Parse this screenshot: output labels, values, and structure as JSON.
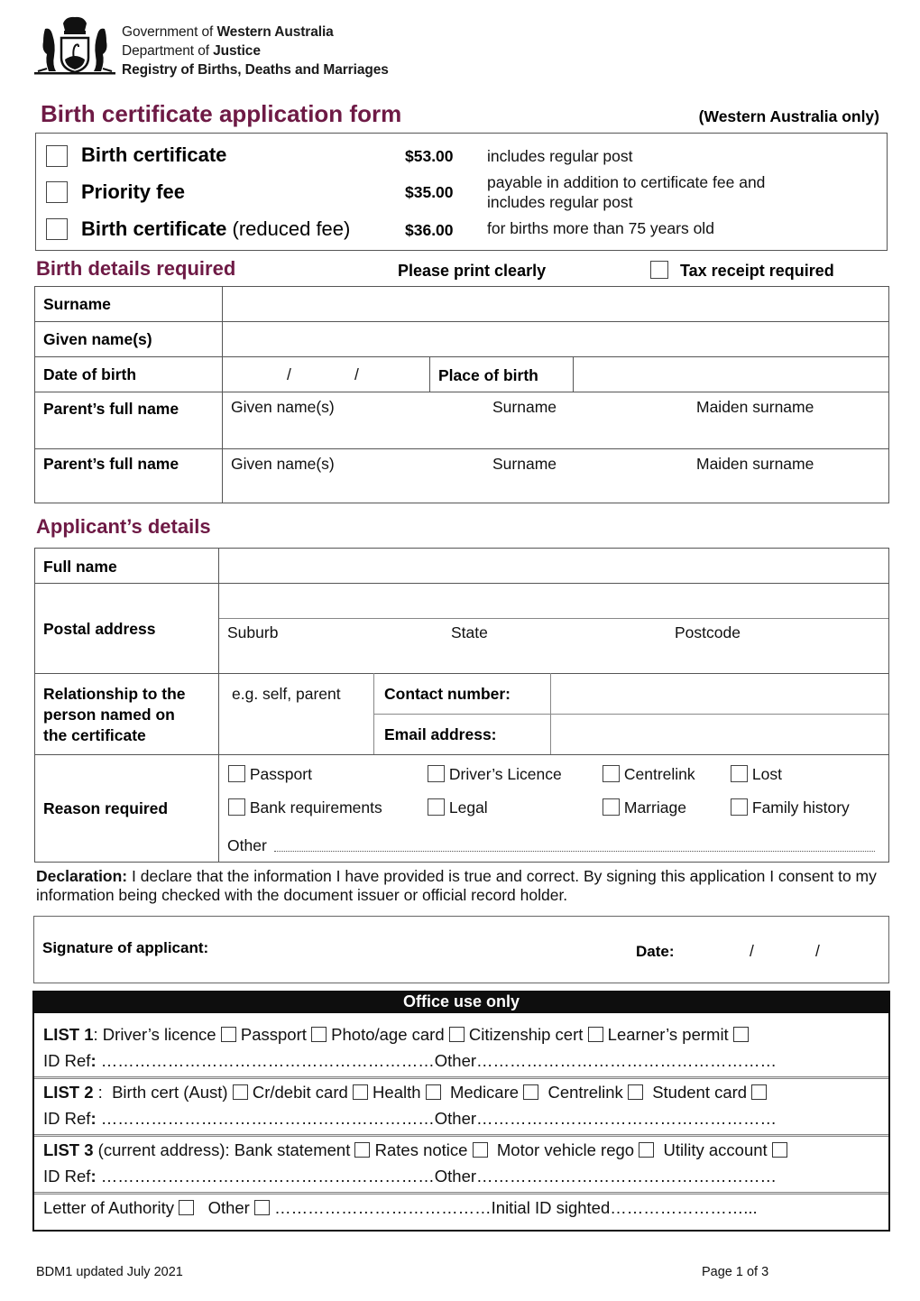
{
  "header": {
    "logo_icon": "wa-coat-of-arms-icon",
    "org_line1_normal": "Government of ",
    "org_line1_bold": "Western Australia",
    "org_line2_normal": "Department of ",
    "org_line2_bold": "Justice",
    "org_line3": "Registry of Births, Deaths and Marriages"
  },
  "title": "Birth certificate application form",
  "title_note": "(Western Australia only)",
  "colors": {
    "accent": "#6e1a45",
    "office_bar": "#0e0e0e"
  },
  "fees": [
    {
      "label": "Birth certificate",
      "label_suffix": "",
      "price": "$53.00",
      "description": [
        "includes regular post"
      ]
    },
    {
      "label": "Priority fee",
      "label_suffix": "",
      "price": "$35.00",
      "description": [
        "payable in addition to certificate fee and",
        "includes regular post"
      ]
    },
    {
      "label": "Birth certificate",
      "label_suffix": " (reduced fee)",
      "price": "$36.00",
      "description": [
        "for births more than 75 years old"
      ]
    }
  ],
  "birth_details": {
    "heading": "Birth details required",
    "print_note": "Please print clearly",
    "tax_receipt": "Tax receipt required",
    "surname": "Surname",
    "given_names": "Given name(s)",
    "date_of_birth": "Date of birth",
    "date_sep": "/",
    "place_of_birth": "Place of birth",
    "parents": [
      {
        "label": "Parent’s full name",
        "given": "Given name(s)",
        "surname": "Surname",
        "maiden": "Maiden surname"
      },
      {
        "label": "Parent’s full name",
        "given": "Given name(s)",
        "surname": "Surname",
        "maiden": "Maiden surname"
      }
    ]
  },
  "applicant": {
    "heading": "Applicant’s details",
    "full_name": "Full name",
    "postal_address": "Postal address",
    "suburb": "Suburb",
    "state": "State",
    "postcode": "Postcode",
    "relationship_lines": [
      "Relationship to the",
      "person named on",
      "the certificate"
    ],
    "relationship_hint": "e.g. self, parent",
    "contact_number": "Contact number:",
    "email_address": "Email address:",
    "reason_required": "Reason required",
    "reasons": [
      "Passport",
      "Driver’s Licence",
      "Centrelink",
      "Lost",
      "Bank requirements",
      "Legal",
      "Marriage",
      "Family history"
    ],
    "other": "Other"
  },
  "declaration": {
    "label": "Declaration:",
    "text": " I declare that the information I have provided is true and correct. By signing this application I consent to my information being checked with the document issuer or official record holder."
  },
  "signature": {
    "label": "Signature of applicant:",
    "date_label": "Date:",
    "date_sep": "/"
  },
  "office": {
    "heading": "Office use only",
    "list1_label": "LIST 1",
    "list1_items": [
      "Driver’s licence",
      "Passport",
      "Photo/age card",
      "Citizenship cert",
      "Learner’s permit"
    ],
    "list2_label": "LIST 2",
    "list2_items": [
      "Birth cert (Aust)",
      "Cr/debit card",
      "Health",
      "Medicare",
      "Centrelink",
      "Student card"
    ],
    "list3_label": "LIST 3",
    "list3_qualifier": " (current address):",
    "list3_items": [
      "Bank statement",
      "Rates notice",
      "Motor vehicle rego",
      "Utility account"
    ],
    "id_ref": "ID Ref",
    "id_ref_dots": "……………………………………………………",
    "other": "Other",
    "other_dots": "………………………………………………",
    "letter_of_authority": "Letter of Authority",
    "other_short": "Other",
    "initial_dots": "…………………………………",
    "initial_id": "Initial ID sighted",
    "initial_tail": "……………………..."
  },
  "footer": {
    "doc_ref": "BDM1 updated July 2021",
    "page": "Page 1 of 3"
  }
}
